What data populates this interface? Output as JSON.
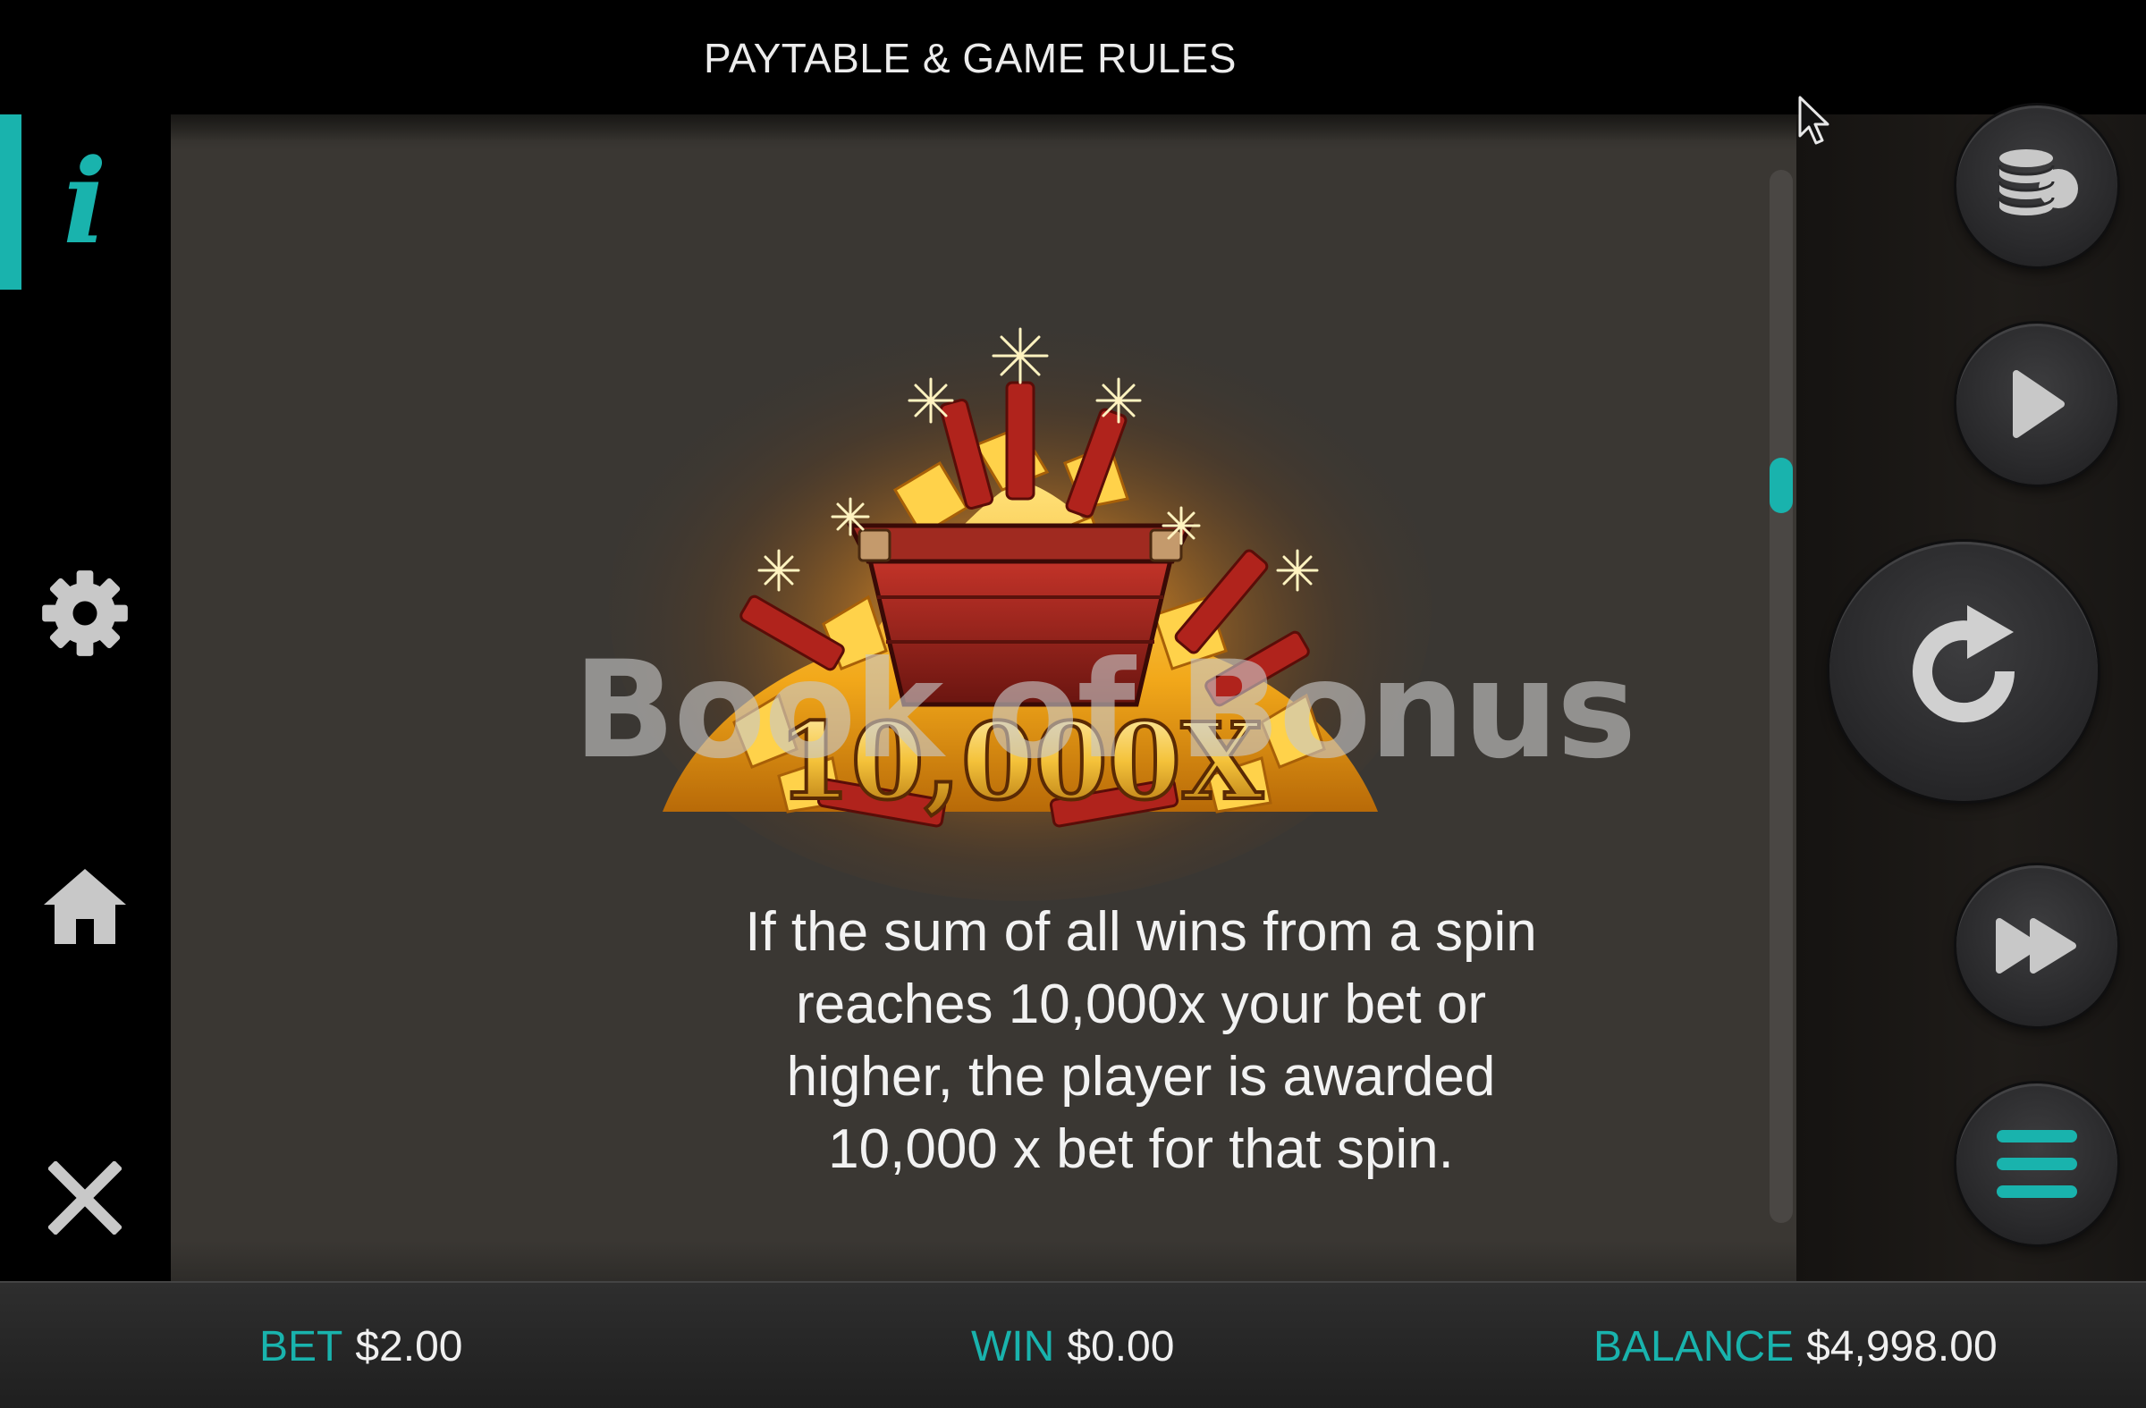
{
  "header": {
    "title": "PAYTABLE & GAME RULES"
  },
  "sidebar": {
    "items": [
      {
        "name": "info",
        "icon": "info-icon",
        "active": true
      },
      {
        "name": "settings",
        "icon": "gear-icon"
      },
      {
        "name": "home",
        "icon": "home-icon"
      },
      {
        "name": "close",
        "icon": "close-icon"
      }
    ]
  },
  "content": {
    "artwork_label": "10,000X",
    "watermark": "Book of Bonus",
    "rule_lines": [
      "If the sum of all wins from a spin",
      "reaches 10,000x your bet or",
      "higher, the player is awarded",
      "10,000 x bet for that spin."
    ]
  },
  "controls": {
    "buttons": [
      "coins-icon",
      "play-icon",
      "spin-icon",
      "fast-forward-icon",
      "menu-icon"
    ]
  },
  "footer": {
    "bet_label": "BET",
    "bet_value": "$2.00",
    "win_label": "WIN",
    "win_value": "$0.00",
    "balance_label": "BALANCE",
    "balance_value": "$4,998.00"
  },
  "colors": {
    "accent": "#19b3ad",
    "panel": "#3a3733",
    "background": "#000000"
  }
}
